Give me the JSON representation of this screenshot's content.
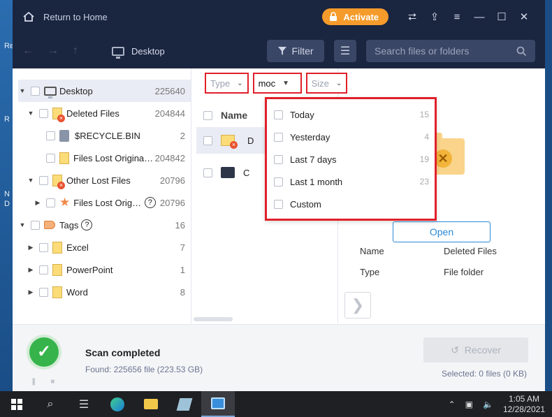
{
  "titlebar": {
    "home_label": "Return to Home",
    "activate_label": "Activate"
  },
  "toolbar": {
    "location": "Desktop",
    "filter_label": "Filter",
    "search_placeholder": "Search files or folders"
  },
  "tree": [
    {
      "label": "Desktop",
      "count": "225640"
    },
    {
      "label": "Deleted Files",
      "count": "204844"
    },
    {
      "label": "$RECYCLE.BIN",
      "count": "2"
    },
    {
      "label": "Files Lost Original ...",
      "count": "204842"
    },
    {
      "label": "Other Lost Files",
      "count": "20796"
    },
    {
      "label": "Files Lost Origin...",
      "count": "20796"
    },
    {
      "label": "Tags",
      "count": "16"
    },
    {
      "label": "Excel",
      "count": "7"
    },
    {
      "label": "PowerPoint",
      "count": "1"
    },
    {
      "label": "Word",
      "count": "8"
    }
  ],
  "filters": {
    "type": "Type",
    "modified": "moc",
    "size": "Size"
  },
  "file_list": {
    "name_header": "Name",
    "rows": [
      "D",
      "C"
    ]
  },
  "dropdown": [
    {
      "label": "Today",
      "count": "15"
    },
    {
      "label": "Yesterday",
      "count": "4"
    },
    {
      "label": "Last 7 days",
      "count": "19"
    },
    {
      "label": "Last 1 month",
      "count": "23"
    },
    {
      "label": "Custom",
      "count": ""
    }
  ],
  "preview": {
    "open_label": "Open",
    "props": [
      {
        "key": "Name",
        "value": "Deleted Files"
      },
      {
        "key": "Type",
        "value": "File folder"
      }
    ]
  },
  "footer": {
    "title": "Scan completed",
    "sub": "Found: 225656 file (223.53 GB)",
    "recover_label": "Recover",
    "selected": "Selected: 0 files (0 KB)"
  },
  "taskbar": {
    "time": "1:05 AM",
    "date": "12/28/2021"
  },
  "colors": {
    "accent": "#f59b2b",
    "header": "#1a2540",
    "highlight": "#e0202a",
    "success": "#36b44b"
  }
}
